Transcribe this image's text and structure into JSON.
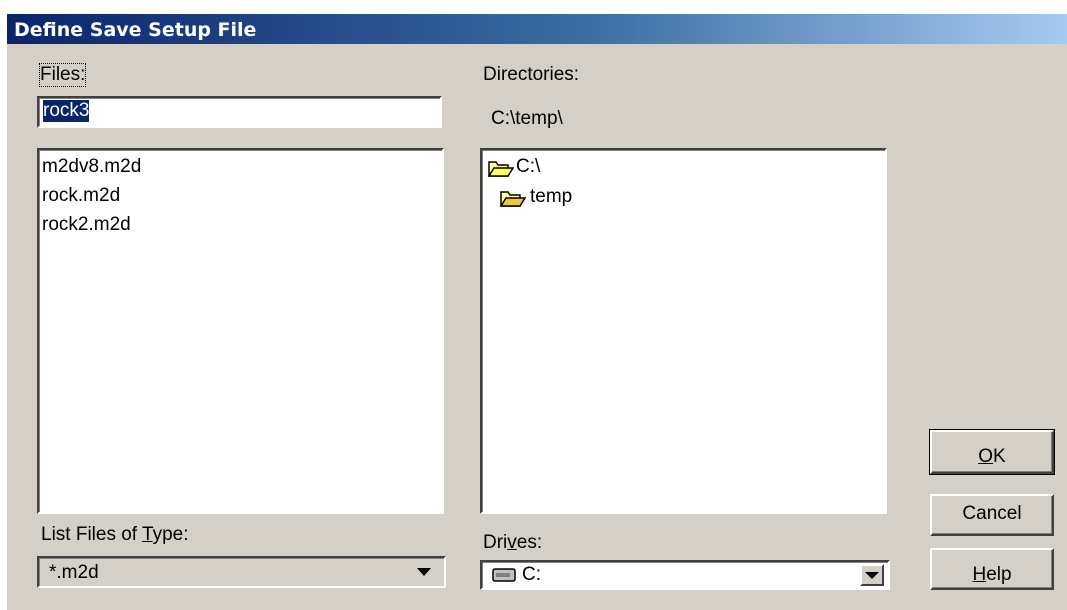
{
  "dialog": {
    "title": "Define Save Setup File"
  },
  "files": {
    "label": "Files:",
    "input_value": "rock3",
    "items": [
      "m2dv8.m2d",
      "rock.m2d",
      "rock2.m2d"
    ]
  },
  "directories": {
    "label": "Directories:",
    "current_path": "C:\\temp\\",
    "tree": [
      {
        "label": "C:\\",
        "icon": "open-folder-icon"
      },
      {
        "label": "temp",
        "icon": "open-folder-icon"
      }
    ]
  },
  "file_type": {
    "label_pre": "List Files of ",
    "label_accel": "T",
    "label_post": "ype:",
    "selected": "*.m2d"
  },
  "drives": {
    "label_pre": "Dri",
    "label_accel": "v",
    "label_post": "es:",
    "selected": "C:",
    "icon": "drive-icon"
  },
  "buttons": {
    "ok_accel": "O",
    "ok_rest": "K",
    "cancel": "Cancel",
    "help_accel": "H",
    "help_rest": "elp"
  },
  "colors": {
    "title_start": "#0a246a",
    "title_end": "#a6caf0",
    "face": "#d4d0c8",
    "selection": "#0a246a"
  }
}
